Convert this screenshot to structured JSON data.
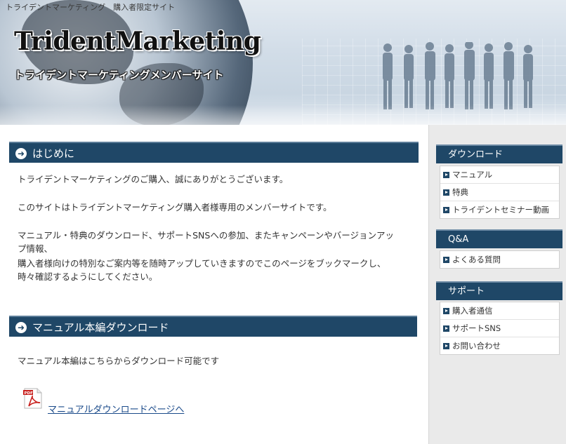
{
  "header": {
    "tagline": "トライデントマーケティング　購入者限定サイト",
    "logo": "TridentMarketing",
    "subtitle": "トライデントマーケティングメンバーサイト"
  },
  "main": {
    "section1": {
      "title": "はじめに",
      "paragraphs": [
        "トライデントマーケティングのご購入、誠にありがとうございます。",
        "このサイトはトライデントマーケティング購入者様専用のメンバーサイトです。",
        "マニュアル・特典のダウンロード、サポートSNSへの参加、またキャンペーンやバージョンアッ",
        "プ情報、",
        "購入者様向けの特別なご案内等を随時アップしていきますのでこのページをブックマークし、",
        "時々確認するようにしてください。"
      ]
    },
    "section2": {
      "title": "マニュアル本編ダウンロード",
      "text": "マニュアル本編はこちらからダウンロード可能です",
      "pdf_label": "PDF",
      "link": "マニュアルダウンロードページへ"
    }
  },
  "sidebar": {
    "download": {
      "title": "ダウンロード",
      "items": [
        "マニュアル",
        "特典",
        "トライデントセミナー動画"
      ]
    },
    "qa": {
      "title": "Q&A",
      "items": [
        "よくある質問"
      ]
    },
    "support": {
      "title": "サポート",
      "items": [
        "購入者通信",
        "サポートSNS",
        "お問い合わせ"
      ]
    }
  },
  "colors": {
    "accent": "#1f4767",
    "link": "#1a4a8a",
    "sidebar_bg": "#eaeaea"
  },
  "icons": [
    "arrow-right-circle-icon",
    "pdf-icon",
    "bullet-arrow-icon"
  ]
}
